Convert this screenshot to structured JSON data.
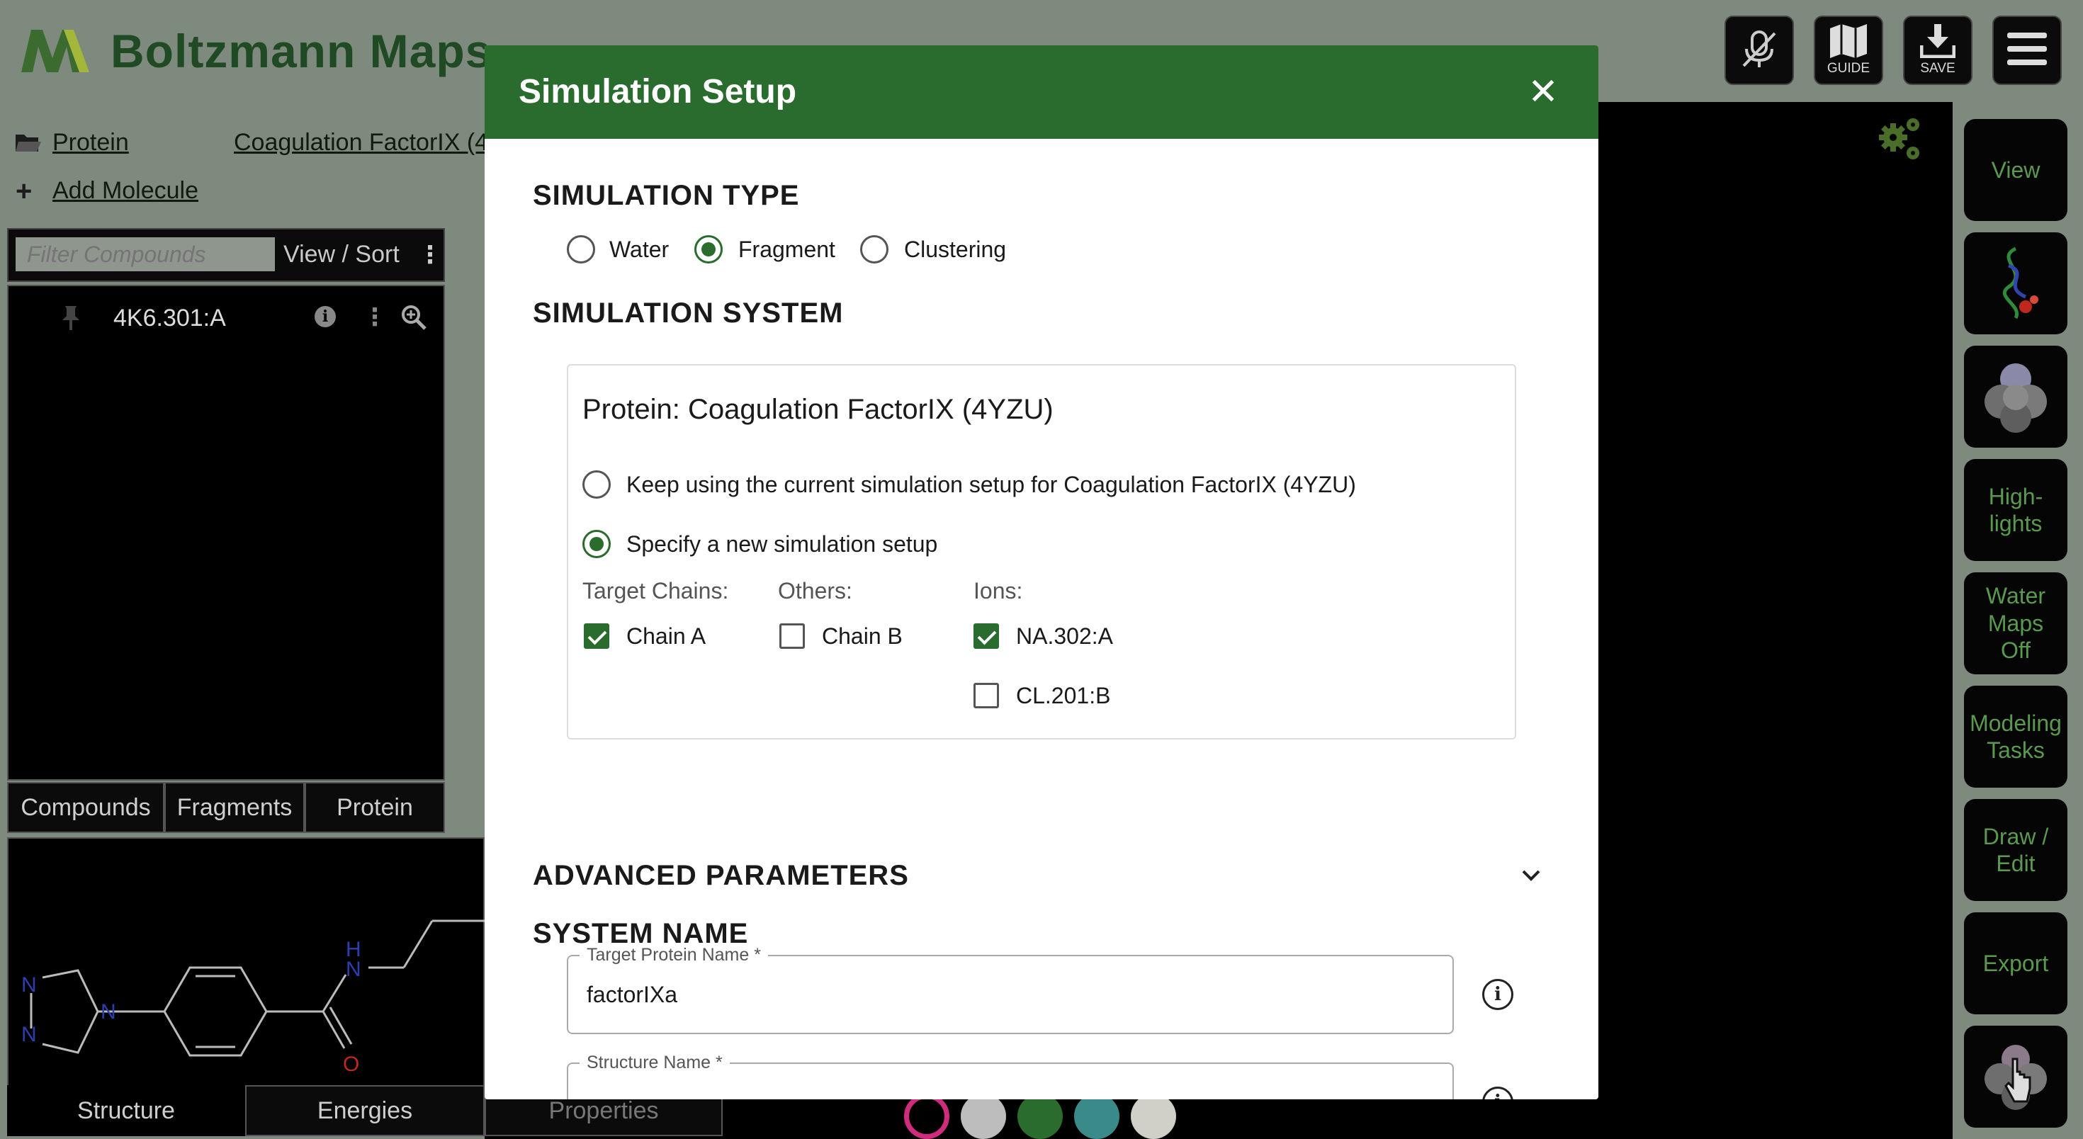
{
  "app": {
    "title": "Boltzmann Maps"
  },
  "toolbar": {
    "mute_icon": "mic-off-icon",
    "guide_label": "GUIDE",
    "save_label": "SAVE",
    "menu_icon": "hamburger-icon"
  },
  "left_panel": {
    "protein_link": "Protein",
    "protein_name": "Coagulation FactorIX (4",
    "add_molecule": "Add Molecule",
    "filter_placeholder": "Filter Compounds",
    "view_sort": "View / Sort",
    "compounds": [
      {
        "name": "4K6.301:A"
      }
    ],
    "tabs": [
      "Compounds",
      "Fragments",
      "Protein"
    ],
    "bottom_tabs": [
      "Structure",
      "Energies",
      "Properties"
    ],
    "structure_atoms": {
      "n": "N",
      "h": "H",
      "o": "O"
    }
  },
  "right_sidebar": {
    "buttons": [
      {
        "label": "View"
      },
      {
        "label": ""
      },
      {
        "label": ""
      },
      {
        "label": "High-\nlights"
      },
      {
        "label": "Water\nMaps\nOff"
      },
      {
        "label": "Modeling\nTasks"
      },
      {
        "label": "Draw /\nEdit"
      },
      {
        "label": "Export"
      },
      {
        "label": ""
      }
    ]
  },
  "swatches": {
    "colors": [
      "#d02c7d",
      "#bdbdbd",
      "#2a6b2e",
      "#3a8a8a",
      "#d0cfc8"
    ]
  },
  "modal": {
    "title": "Simulation Setup",
    "simulation_type": {
      "heading": "SIMULATION TYPE",
      "options": [
        "Water",
        "Fragment",
        "Clustering"
      ],
      "selected": "Fragment"
    },
    "simulation_system": {
      "heading": "SIMULATION SYSTEM",
      "protein_title": "Protein: Coagulation FactorIX (4YZU)",
      "keep_option": "Keep using the current simulation setup for Coagulation FactorIX (4YZU)",
      "new_option": "Specify a new simulation setup",
      "selected": "new",
      "target_chains_label": "Target Chains:",
      "others_label": "Others:",
      "ions_label": "Ions:",
      "target_chains": [
        {
          "label": "Chain A",
          "checked": true
        }
      ],
      "others": [
        {
          "label": "Chain B",
          "checked": false
        }
      ],
      "ions": [
        {
          "label": "NA.302:A",
          "checked": true
        },
        {
          "label": "CL.201:B",
          "checked": false
        }
      ]
    },
    "advanced": {
      "heading": "ADVANCED PARAMETERS"
    },
    "system_name": {
      "heading": "SYSTEM NAME",
      "target_protein_label": "Target Protein Name *",
      "target_protein_value": "factorIXa",
      "structure_name_label": "Structure Name *",
      "structure_name_value": ""
    }
  },
  "colors": {
    "brand_green": "#2a6b2e",
    "side_text": "#5a9a4f",
    "topbar": "#7e8a7e"
  }
}
